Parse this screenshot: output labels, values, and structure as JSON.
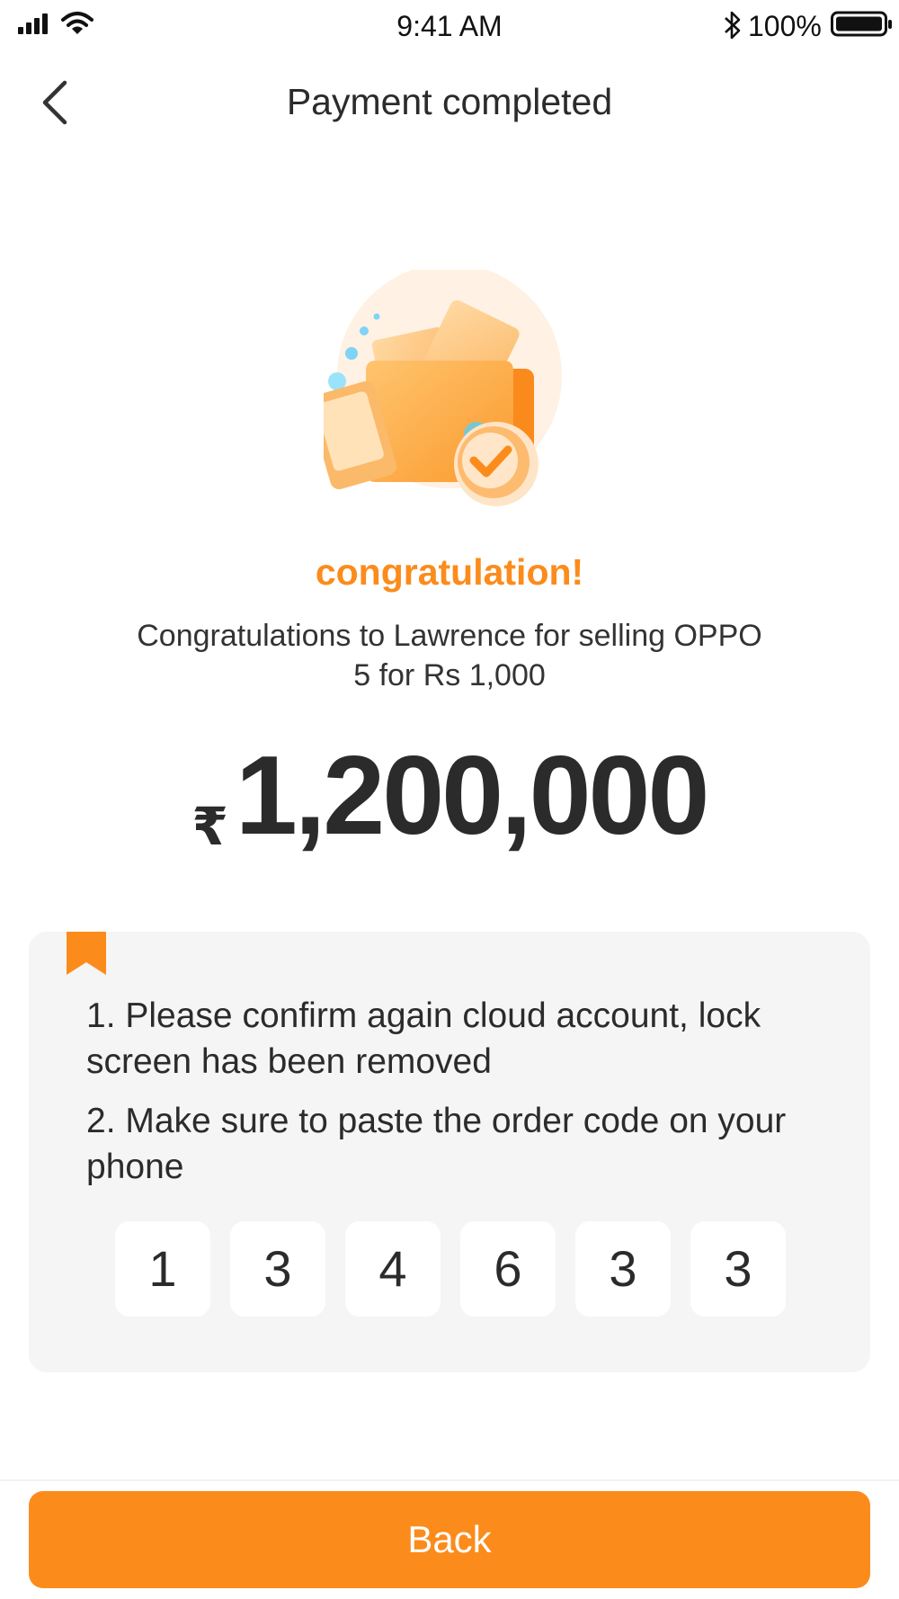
{
  "status_bar": {
    "time": "9:41 AM",
    "battery_percent": "100%",
    "icons": [
      "signal-icon",
      "wifi-icon",
      "bluetooth-icon",
      "battery-icon"
    ]
  },
  "header": {
    "title": "Payment completed",
    "back_icon": "chevron-left-icon"
  },
  "illustration": {
    "icon": "wallet-payment-success-illustration"
  },
  "result": {
    "heading": "congratulation!",
    "message": "Congratulations to Lawrence for selling OPPO 5 for Rs 1,000",
    "currency_symbol": "₹",
    "amount": "1,200,000"
  },
  "notice": {
    "bookmark_icon": "bookmark-icon",
    "items": [
      "1. Please confirm again cloud account, lock screen has been removed",
      "2. Make sure to paste the order code on your phone"
    ],
    "order_code": [
      "1",
      "3",
      "4",
      "6",
      "3",
      "3"
    ]
  },
  "footer": {
    "back_label": "Back"
  },
  "colors": {
    "accent": "#FB8C1C",
    "card_background": "#F5F5F5",
    "text": "#2B2B2B"
  }
}
